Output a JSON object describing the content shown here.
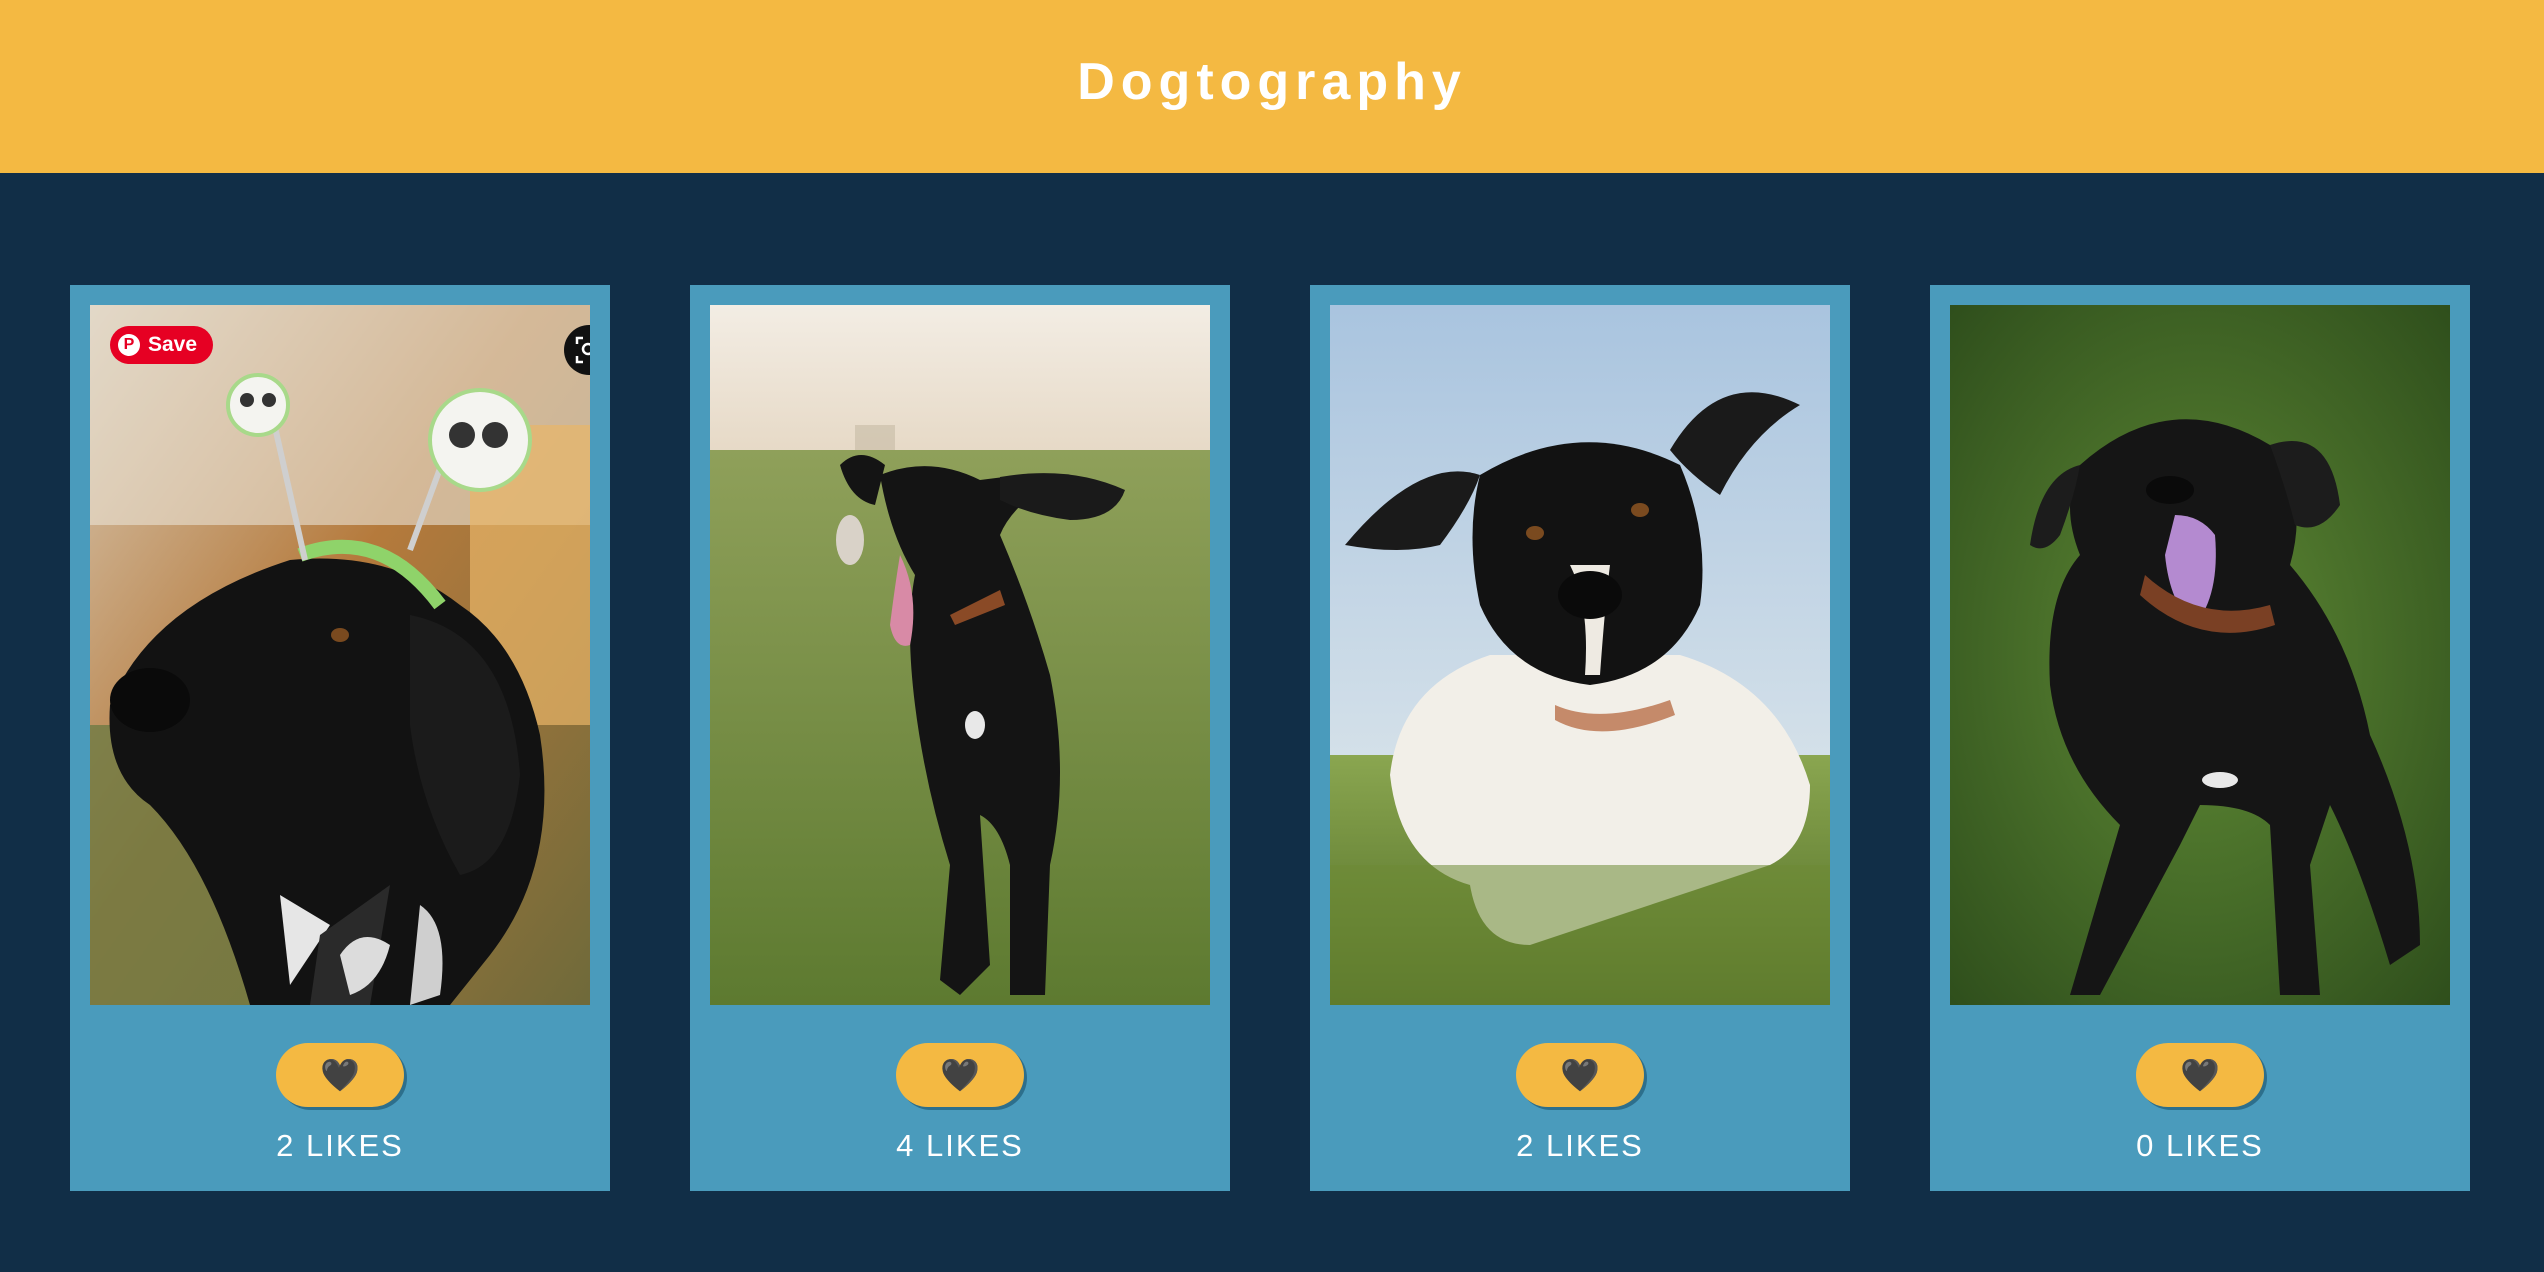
{
  "header": {
    "title": "Dogtography"
  },
  "pinterest": {
    "save_label": "Save",
    "logo_glyph": "P"
  },
  "like_icon": "black-heart",
  "like_glyph": "🖤",
  "cards": [
    {
      "photo": "black dog with skull headband",
      "likes_text": "2 LIKES"
    },
    {
      "photo": "black dog running in field",
      "likes_text": "4 LIKES"
    },
    {
      "photo": "black and white dog lying in grass",
      "likes_text": "2 LIKES"
    },
    {
      "photo": "black dog standing on grass",
      "likes_text": "0 LIKES"
    }
  ],
  "colors": {
    "header_bg": "#f4b942",
    "page_bg": "#112e47",
    "card_bg": "#4a9bbc",
    "button_bg": "#f4b942"
  }
}
